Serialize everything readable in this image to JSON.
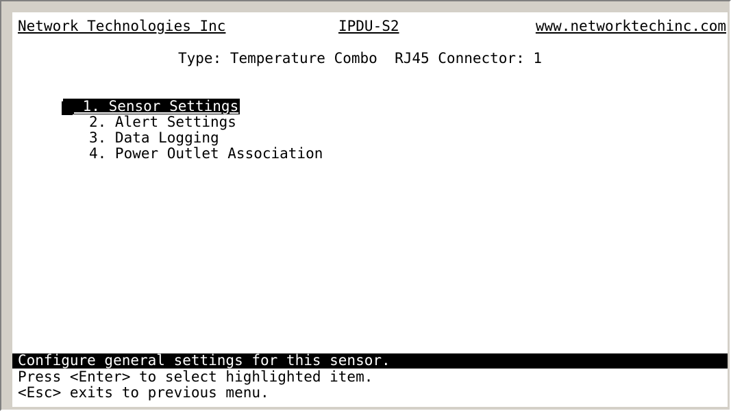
{
  "header": {
    "company": "Network Technologies Inc",
    "product": "IPDU-S2",
    "website": "www.networktechinc.com"
  },
  "subtitle": "Type: Temperature Combo  RJ45 Connector: 1",
  "menu": {
    "selected_index": 0,
    "items": [
      {
        "label": " 1. Sensor Settings"
      },
      {
        "label": "2. Alert Settings"
      },
      {
        "label": "3. Data Logging"
      },
      {
        "label": "4. Power Outlet Association"
      }
    ]
  },
  "status": "Configure general settings for this sensor.",
  "help": [
    "Press <Enter> to select highlighted item.",
    "<Esc> exits to previous menu."
  ],
  "colors": {
    "background": "#ffffff",
    "text": "#000000",
    "highlight_bg": "#000000",
    "highlight_fg": "#ffffff",
    "window_chrome": "#d4d0c8"
  }
}
